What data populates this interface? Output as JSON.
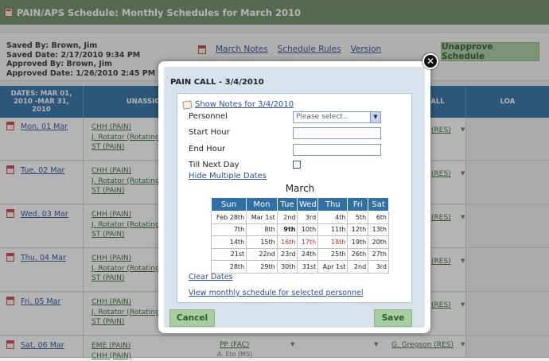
{
  "window": {
    "title": "PAIN/APS Schedule: Monthly Schedules for March 2010"
  },
  "info": {
    "saved_by": "Saved By: Brown, Jim",
    "saved_date": "Saved Date: 2/17/2010 9:34 PM",
    "approved_by": "Approved By: Brown, Jim",
    "approved_date": "Approved Date: 1/26/2010 2:45 PM"
  },
  "links": {
    "notes": "March Notes",
    "rules": "Schedule Rules",
    "version": "Version"
  },
  "unapprove_label": "Unapprove Schedule",
  "grid": {
    "dates_header": "DATES: MAR 01, 2010 -MAR 31, 2010",
    "unassigned_header": "UNASSIG",
    "call_header": "ALL",
    "loa_header": "LOA",
    "rows": [
      {
        "date": "Mon, 01 Mar",
        "items": [
          "CHH (PAIN)",
          "J. Rotator (Rotating",
          "ST (PAIN)"
        ],
        "res": "(RES)"
      },
      {
        "date": "Tue, 02 Mar",
        "items": [
          "CHH (PAIN)",
          "J. Rotator (Rotating",
          "ST (PAIN)"
        ],
        "res": "(RES)"
      },
      {
        "date": "Wed, 03 Mar",
        "items": [
          "CHH (PAIN)",
          "J. Rotator (Rotating",
          "ST (PAIN)"
        ],
        "res": "(RES)"
      },
      {
        "date": "Thu, 04 Mar",
        "items": [
          "CHH (PAIN)",
          "J. Rotator (Rotating",
          "ST (PAIN)"
        ],
        "res": "(RES)"
      },
      {
        "date": "Fri, 05 Mar",
        "items": [
          "CHH (PAIN)",
          "J. Rotator (Rotating",
          "ST (PAIN)"
        ],
        "res": "(RES)"
      },
      {
        "date": "Sat, 06 Mar",
        "items": [
          "EME (PAIN)",
          "CHH (PAIN)"
        ],
        "res": "G. Gregson (RES)",
        "extra": "PP (FAC)",
        "extra2": "A. Eto (MS)"
      }
    ]
  },
  "modal": {
    "title": "PAIN CALL - 3/4/2010",
    "show_notes": "Show Notes for 3/4/2010",
    "personnel_label": "Personnel",
    "personnel_value": "Please select..",
    "start_hour_label": "Start Hour",
    "end_hour_label": "End Hour",
    "till_next_day_label": "Till Next Day",
    "hide_multiple_dates": "Hide Multiple Dates",
    "calendar": {
      "month": "March",
      "weekdays": [
        "Sun",
        "Mon",
        "Tue",
        "Wed",
        "Thu",
        "Fri",
        "Sat"
      ],
      "weeks": [
        [
          "Feb 28th",
          "Mar 1st",
          "2nd",
          "3rd",
          "4th",
          "5th",
          "6th"
        ],
        [
          "7th",
          "8th",
          "9th",
          "10th",
          "11th",
          "12th",
          "13th"
        ],
        [
          "14th",
          "15th",
          "16th",
          "17th",
          "18th",
          "19th",
          "20th"
        ],
        [
          "21st",
          "22nd",
          "23rd",
          "24th",
          "25th",
          "26th",
          "27th"
        ],
        [
          "28th",
          "29th",
          "30th",
          "31st",
          "Apr 1st",
          "2nd",
          "3rd"
        ]
      ],
      "selected_days": [
        "16th",
        "17th",
        "18th"
      ],
      "bold_day": "9th"
    },
    "clear_dates": "Clear Dates",
    "view_monthly": "View monthly schedule for selected personnel",
    "cancel_label": "Cancel",
    "save_label": "Save",
    "close_glyph": "✕"
  },
  "colors": {
    "header_green": "#6f8e68",
    "grid_blue": "#2f70a6",
    "button_green": "#a8cda0",
    "selected_red": "#d12a2a",
    "link_blue": "#2c4f9a"
  }
}
